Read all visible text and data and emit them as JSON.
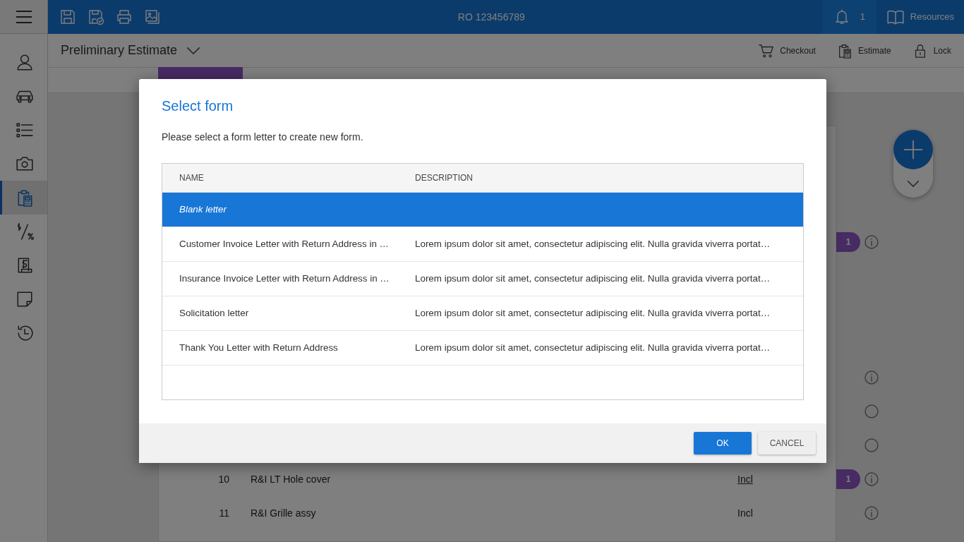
{
  "app_bar": {
    "title": "RO 123456789",
    "notification_count": "1",
    "resources": "Resources"
  },
  "toolbar": [
    {
      "kind": "save"
    },
    {
      "kind": "save-check"
    },
    {
      "kind": "print"
    },
    {
      "kind": "images"
    }
  ],
  "sidebar": {
    "items": [
      {
        "kind": "person",
        "selected": false
      },
      {
        "kind": "car",
        "selected": false
      },
      {
        "kind": "list",
        "selected": false
      },
      {
        "kind": "camera",
        "selected": false
      },
      {
        "kind": "estimate",
        "selected": true
      },
      {
        "kind": "percent",
        "selected": false
      },
      {
        "kind": "invoice",
        "selected": false
      },
      {
        "kind": "note",
        "selected": false
      },
      {
        "kind": "history",
        "selected": false
      }
    ]
  },
  "header": {
    "title": "Preliminary Estimate",
    "actions": [
      {
        "kind": "cart",
        "label": "Checkout"
      },
      {
        "kind": "estimate",
        "label": "Estimate"
      },
      {
        "kind": "lock",
        "label": "Lock"
      }
    ]
  },
  "lines": [
    {
      "kind": "info",
      "badge": "1"
    },
    {
      "kind": "info"
    },
    {
      "kind": "circle"
    },
    {
      "kind": "circle"
    },
    {
      "number": "10",
      "description": "R&I LT Hole cover",
      "amount": "Incl",
      "linked": true,
      "kind": "info",
      "badge": "1"
    },
    {
      "number": "11",
      "description": "R&I Grille assy",
      "amount": "Incl",
      "linked": false,
      "kind": "info"
    }
  ],
  "dialog": {
    "title": "Select form",
    "message": "Please select a form letter to create new form.",
    "columns": [
      "NAME",
      "DESCRIPTION"
    ],
    "rows": [
      {
        "kind": "blank",
        "name": "Blank letter",
        "selected": true
      },
      {
        "kind": "template",
        "name": "Customer Invoice Letter with Return Address in …",
        "description": "Lorem ipsum dolor sit amet, consectetur adipiscing elit. Nulla gravida viverra portat…",
        "selected": false
      },
      {
        "kind": "template",
        "name": "Insurance Invoice Letter with Return Address in …",
        "description": "Lorem ipsum dolor sit amet, consectetur adipiscing elit. Nulla gravida viverra portat…",
        "selected": false
      },
      {
        "kind": "template",
        "name": "Solicitation letter",
        "description": "Lorem ipsum dolor sit amet, consectetur adipiscing elit. Nulla gravida viverra portat…",
        "selected": false
      },
      {
        "kind": "template",
        "name": "Thank You Letter with Return Address",
        "description": "Lorem ipsum dolor sit amet, consectetur adipiscing elit. Nulla gravida viverra portat…",
        "selected": false
      }
    ],
    "buttons": [
      {
        "kind": "primary",
        "label": "OK"
      },
      {
        "kind": "secondary",
        "label": "CANCEL"
      }
    ]
  }
}
